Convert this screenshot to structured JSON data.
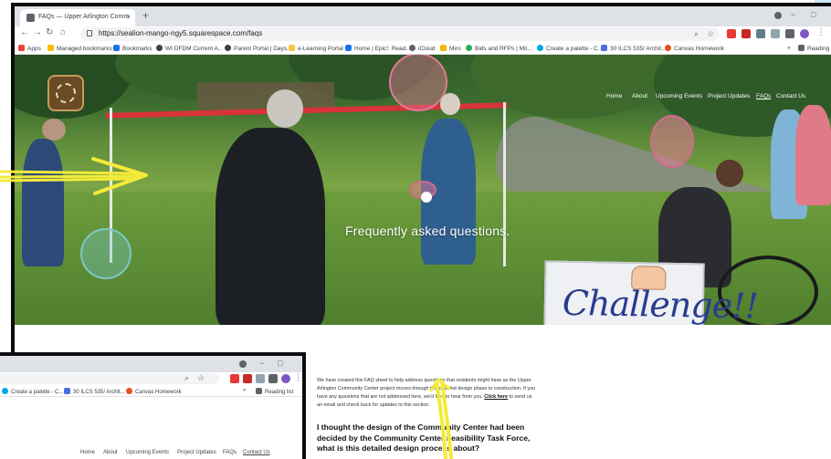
{
  "browser": {
    "tab_title": "FAQs — Upper Arlington Comm",
    "tab_close": "×",
    "new_tab": "+",
    "url": "https://sealion-mango-ngy5.squarespace.com/faqs",
    "window_controls": [
      "−",
      "□"
    ],
    "bookmarks": [
      {
        "label": "Apps",
        "color": "#ea4335"
      },
      {
        "label": "Managed bookmarks",
        "color": "#fbbc04"
      },
      {
        "label": "Bookmarks",
        "color": "#1a73e8"
      },
      {
        "label": "WI DFDM Current A...",
        "color": "#3c4043"
      },
      {
        "label": "Parent Portal | Days...",
        "color": "#3c4043"
      },
      {
        "label": "e-Learning Portal",
        "color": "#f6c343"
      },
      {
        "label": "Home | Epic!: Read...",
        "color": "#1a73e8"
      },
      {
        "label": "iCloud",
        "color": "#5f6368"
      },
      {
        "label": "Miro",
        "color": "#f2b705"
      },
      {
        "label": "Bids and RFPs | Mil...",
        "color": "#34a853"
      },
      {
        "label": "Create a palette - C...",
        "color": "#00a8e8"
      },
      {
        "label": "30 ILCS 535/ Archit...",
        "color": "#4a6ee0"
      },
      {
        "label": "Canvas Homework",
        "color": "#e94e1b"
      }
    ],
    "more_bookmarks": "»",
    "reading_list": "Reading"
  },
  "site": {
    "nav": [
      "Home",
      "About",
      "Upcoming Events",
      "Project Updates",
      "FAQs",
      "Contact Us"
    ],
    "active_nav": "FAQs",
    "hero_title": "Frequently asked questions.",
    "sign_text": "Challenge!!",
    "intro_before_link": "We have created this FAQ sheet to help address questions that residents might have as the Upper Arlington Community Center project moves through this detailed design phase to construction. If you have any questions that are not addressed here, we'd love to hear from you. ",
    "intro_link": "Click here",
    "intro_after_link": " to send us an email and check back for updates to this section.",
    "question_1": "I thought the design of the Community Center had been decided by the Community Center Feasibility Task Force, what is this detailed design process about?"
  },
  "second_window": {
    "bookmarks": [
      {
        "label": "Create a palette - C...",
        "color": "#00a8e8"
      },
      {
        "label": "30 ILCS 535/ Archit...",
        "color": "#4a6ee0"
      },
      {
        "label": "Canvas Homework",
        "color": "#e94e1b"
      }
    ],
    "reading_list": "Reading list",
    "nav": [
      "Home",
      "About",
      "Upcoming Events",
      "Project Updates",
      "FAQs",
      "Contact Us"
    ],
    "active_nav": "Contact Us"
  },
  "colors": {
    "annotation_yellow": "#f3ea3a",
    "net_red": "#d8333a",
    "sign_blue": "#2a3b8f"
  }
}
